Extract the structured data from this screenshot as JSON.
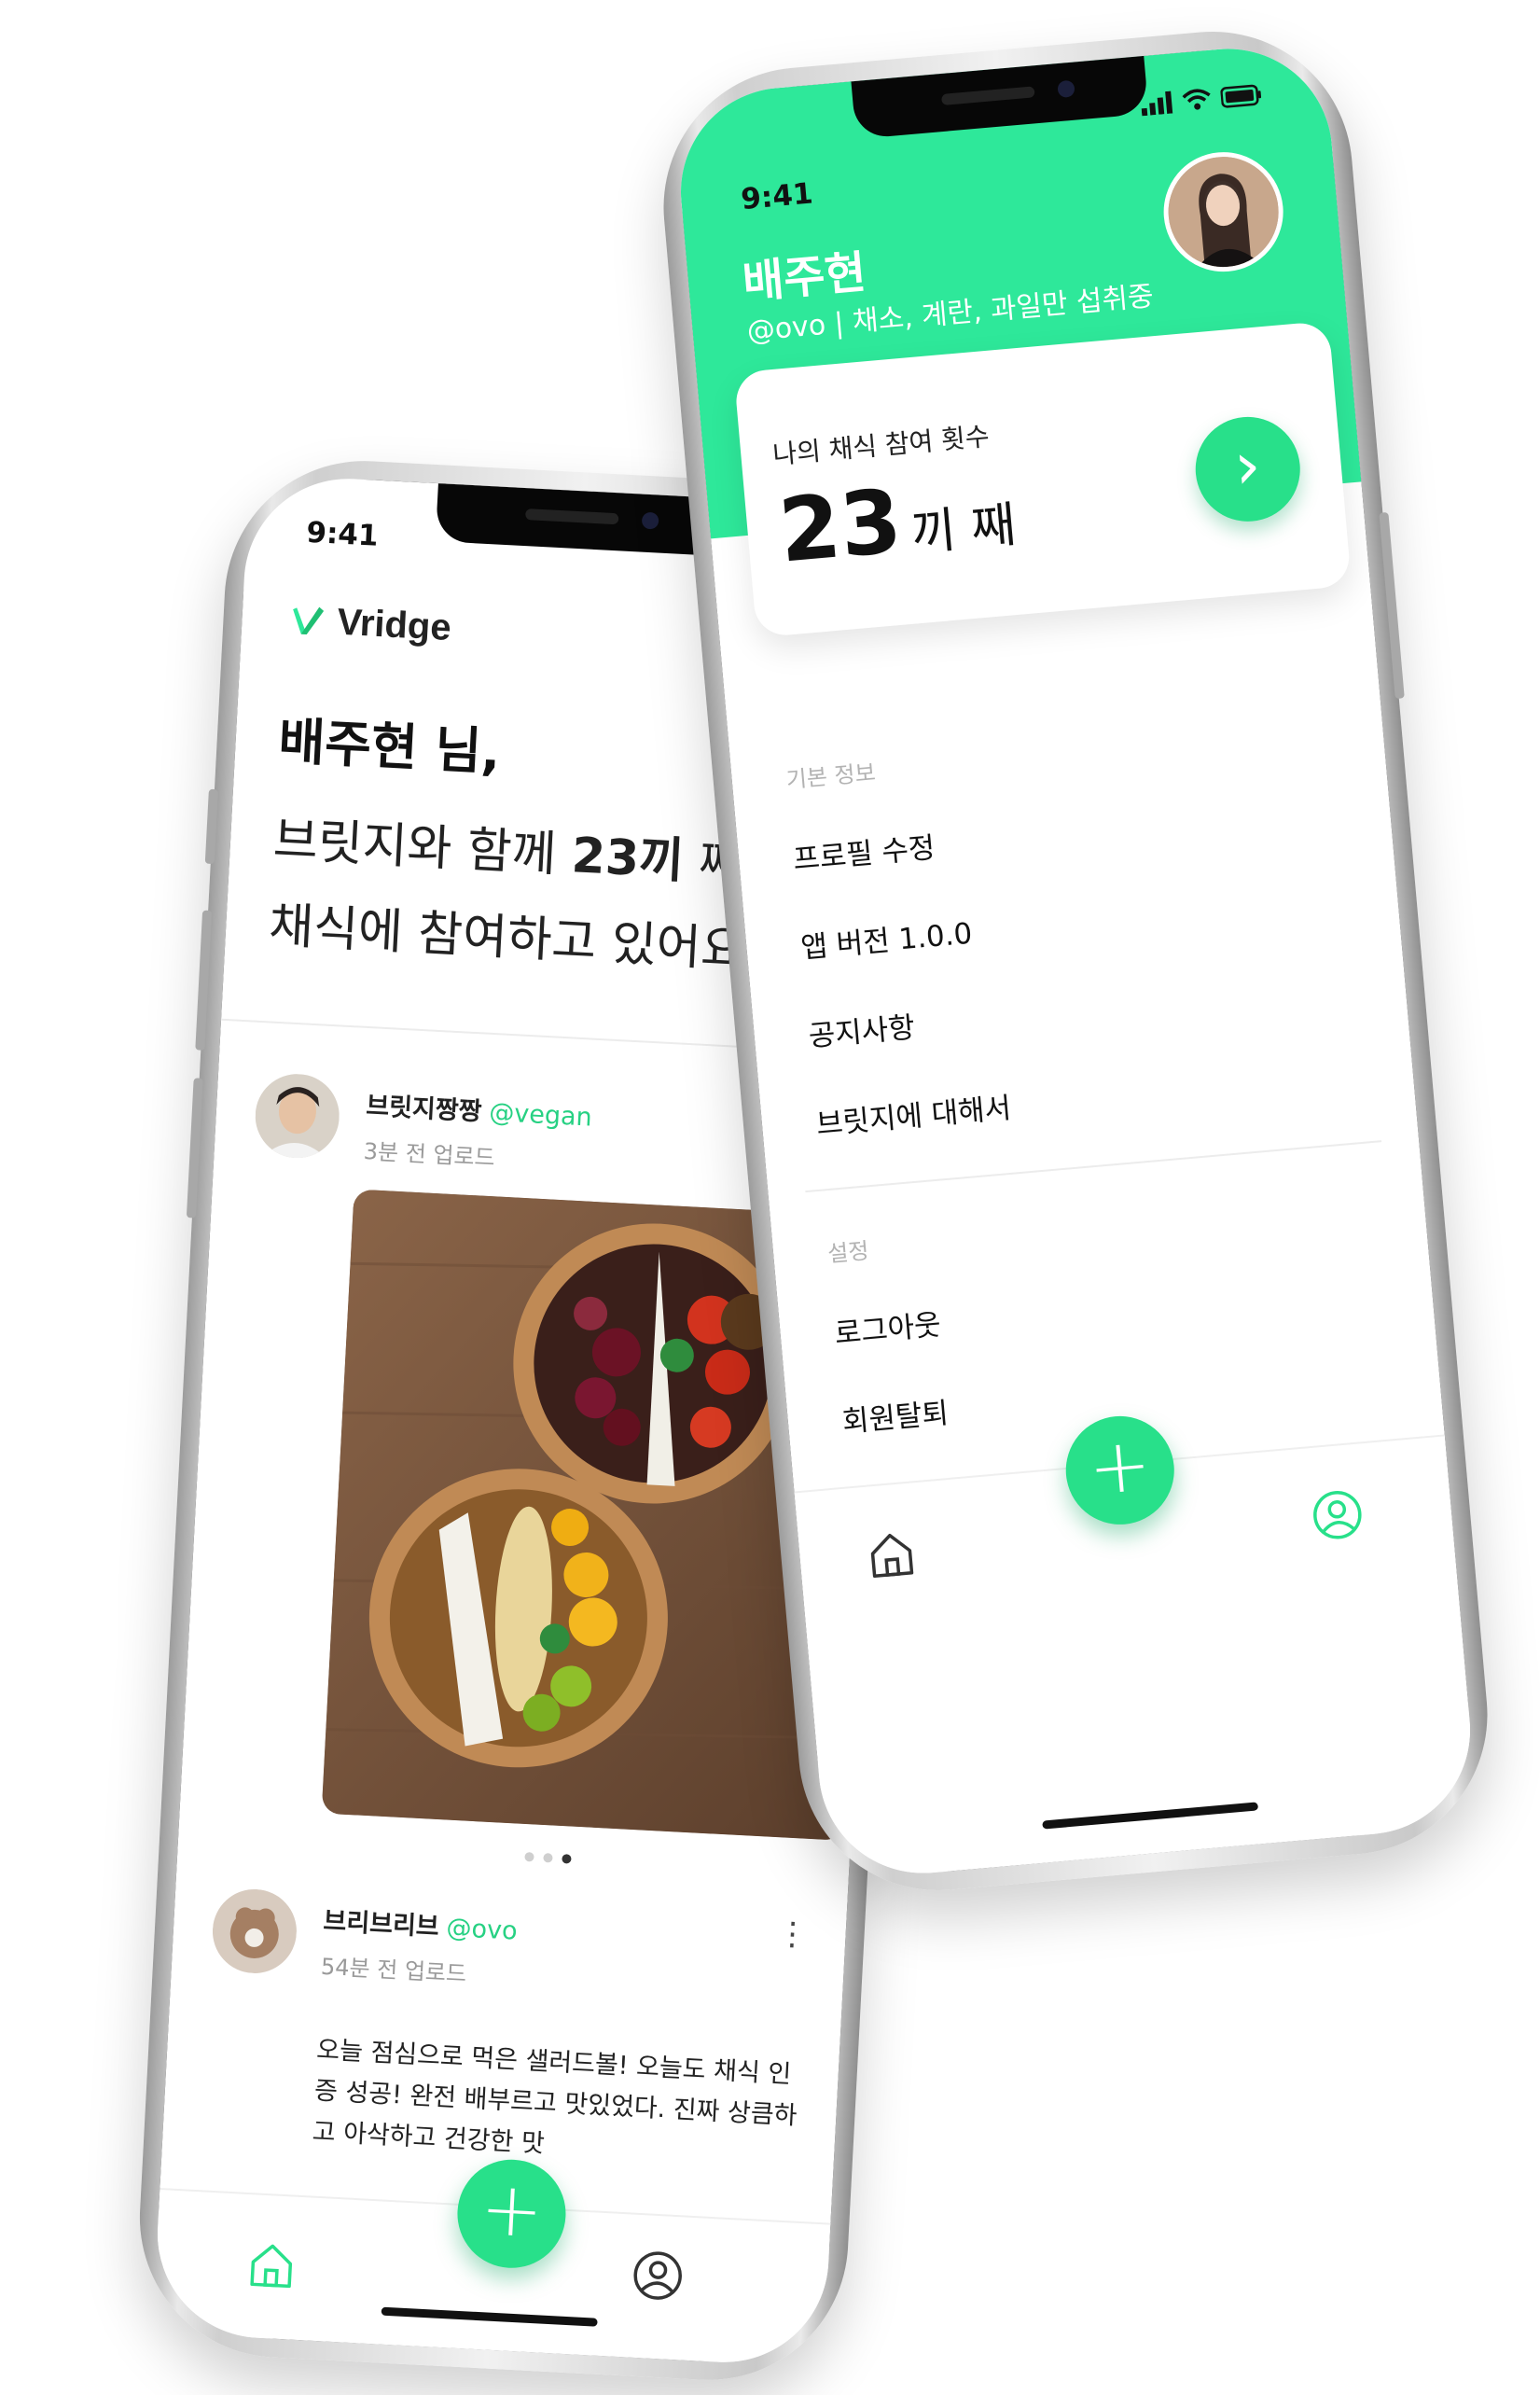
{
  "left_phone": {
    "status_time": "9:41",
    "brand": "Vridge",
    "greeting": {
      "name_line": "배주현 님,",
      "line2_pre": "브릿지와 함께 ",
      "line2_count": "23끼",
      "line2_post": " 째",
      "line3": "채식에 참여하고 있어요!"
    },
    "posts": [
      {
        "author": "브릿지짱짱",
        "tag": "@vegan",
        "time": "3분 전 업로드",
        "photo_dots": 3,
        "active_dot": 3
      },
      {
        "author": "브리브리브",
        "tag": "@ovo",
        "time": "54분 전 업로드",
        "text": "오늘 점심으로 먹은 샐러드볼! 오늘도 채식 인증 성공! 완전 배부르고 맛있었다. 진짜 상큼하고 아삭하고 건강한 맛"
      }
    ],
    "tabbar": {
      "fab_label": "+",
      "active_tab": "home"
    }
  },
  "right_phone": {
    "status_time": "9:41",
    "profile": {
      "name": "배주현",
      "subtitle": "@ovo | 채소, 계란, 과일만 섭취중"
    },
    "count_card": {
      "label": "나의 채식 참여 횟수",
      "value": "23",
      "unit": "끼 째",
      "go_icon": "chevron-right-icon"
    },
    "sections": [
      {
        "title": "기본 정보",
        "items": [
          "프로필 수정",
          "앱 버전 1.0.0",
          "공지사항",
          "브릿지에 대해서"
        ]
      },
      {
        "title": "설정",
        "items": [
          "로그아웃",
          "회원탈퇴"
        ]
      }
    ],
    "tabbar": {
      "fab_label": "+",
      "active_tab": "profile"
    }
  },
  "colors": {
    "brand_green": "#2ee89a",
    "fab_green": "#28e08a",
    "tag_green": "#27d183"
  }
}
